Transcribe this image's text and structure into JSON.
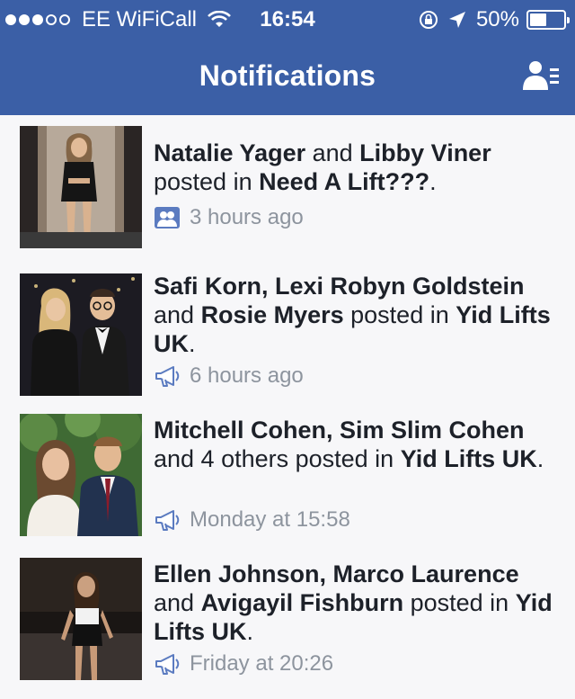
{
  "status_bar": {
    "carrier": "EE WiFiCall",
    "time": "16:54",
    "battery": "50%",
    "battery_level": 0.5,
    "signal_bars_filled": 3,
    "signal_bars_total": 5
  },
  "header": {
    "title": "Notifications",
    "color": "#3b5fa6"
  },
  "notifications": [
    {
      "parts": [
        {
          "t": "Natalie Yager",
          "b": true
        },
        {
          "t": " and ",
          "b": false
        },
        {
          "t": "Libby Viner",
          "b": true
        },
        {
          "t": " posted in ",
          "b": false
        },
        {
          "t": "Need A Lift???",
          "b": true
        },
        {
          "t": ".",
          "b": false
        }
      ],
      "time": "3 hours ago",
      "icon": "group-icon"
    },
    {
      "parts": [
        {
          "t": "Safi Korn, Lexi Robyn Goldstein",
          "b": true
        },
        {
          "t": " and ",
          "b": false
        },
        {
          "t": "Rosie Myers",
          "b": true
        },
        {
          "t": " posted in ",
          "b": false
        },
        {
          "t": "Yid Lifts UK",
          "b": true
        },
        {
          "t": ".",
          "b": false
        }
      ],
      "time": "6 hours ago",
      "icon": "megaphone-icon"
    },
    {
      "parts": [
        {
          "t": "Mitchell Cohen, Sim Slim Cohen",
          "b": true
        },
        {
          "t": " and 4 others posted in ",
          "b": false
        },
        {
          "t": "Yid Lifts UK",
          "b": true
        },
        {
          "t": ".",
          "b": false
        }
      ],
      "time": "Monday at 15:58",
      "icon": "megaphone-icon"
    },
    {
      "parts": [
        {
          "t": "Ellen Johnson, Marco Laurence",
          "b": true
        },
        {
          "t": " and ",
          "b": false
        },
        {
          "t": "Avigayil Fishburn",
          "b": true
        },
        {
          "t": " posted in ",
          "b": false
        },
        {
          "t": "Yid Lifts UK",
          "b": true
        },
        {
          "t": ".",
          "b": false
        }
      ],
      "time": "Friday at 20:26",
      "icon": "megaphone-icon"
    }
  ]
}
